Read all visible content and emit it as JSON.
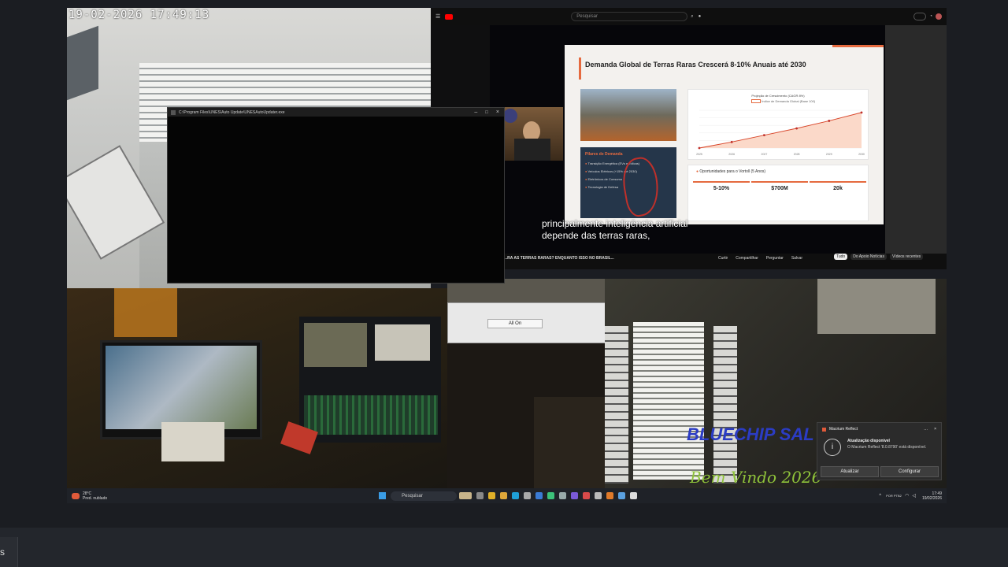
{
  "camera_tl": {
    "timestamp": "19-02-2026  17:49:13"
  },
  "terminal": {
    "title": "C:\\Program Files\\UNES\\Auto Update\\UNESAutoUpdater.exe"
  },
  "browser": {
    "search_placeholder": "Pesquisar",
    "slide": {
      "title": "Demanda Global de Terras Raras Crescerá 8-10% Anuais até 2030",
      "dark_card_title": "Pilares de Demanda",
      "dark_card_items": [
        "Transição Energética (EVs e eólicas)",
        "Veículos Elétricos (+15% até 2030)",
        "Eletrônicos de Consumo",
        "Tecnologia de Defesa"
      ],
      "chart_title": "Projeção de Crescimento (CAGR 8%)",
      "chart_legend": "Índice de Demanda Global (Base 100)",
      "opportunity_title": "Oportunidades para o Vortoll (5 Anos)",
      "stats": [
        {
          "value": "5-10%"
        },
        {
          "value": "$700M"
        },
        {
          "value": "20k"
        }
      ]
    },
    "subtitle_lines": [
      "principalmente inteligência artificial",
      "depende das terras raras,"
    ],
    "video_title": "...RA AS TERRAS RARAS? ENQUANTO ISSO NO BRASIL...",
    "actions": [
      "Curtir",
      "Compartilhar",
      "Perguntar",
      "Salvar"
    ],
    "side_chips": [
      "Tudo",
      "Do Apoio Notícias",
      "Vídeos recentes"
    ]
  },
  "chart_data": {
    "type": "line",
    "x": [
      2025,
      2026,
      2027,
      2028,
      2029,
      2030
    ],
    "series": [
      {
        "name": "Índice de Demanda Global (Base 100)",
        "values": [
          100,
          108,
          117,
          126,
          136,
          147
        ]
      }
    ],
    "ylim": [
      100,
      150
    ]
  },
  "dialog": {
    "button": "All On"
  },
  "camera_br": {
    "overlay_text_1": "BLUECHIP SAL",
    "overlay_text_2": "Bem Vindo 2026"
  },
  "toast": {
    "app": "Macrium Reflect",
    "heading": "Atualização disponível",
    "body": "O Macrium Reflect '8.0.8790' está disponível.",
    "btn_update": "Atualizar",
    "btn_config": "Configurar"
  },
  "taskbar": {
    "weather_temp": "28°C",
    "weather_text": "Pred. nublado",
    "search_placeholder": "Pesquisar",
    "lang": "POR PTB2",
    "time": "17:49",
    "date": "19/02/2026"
  },
  "bottom_bar": {
    "text": "s"
  }
}
